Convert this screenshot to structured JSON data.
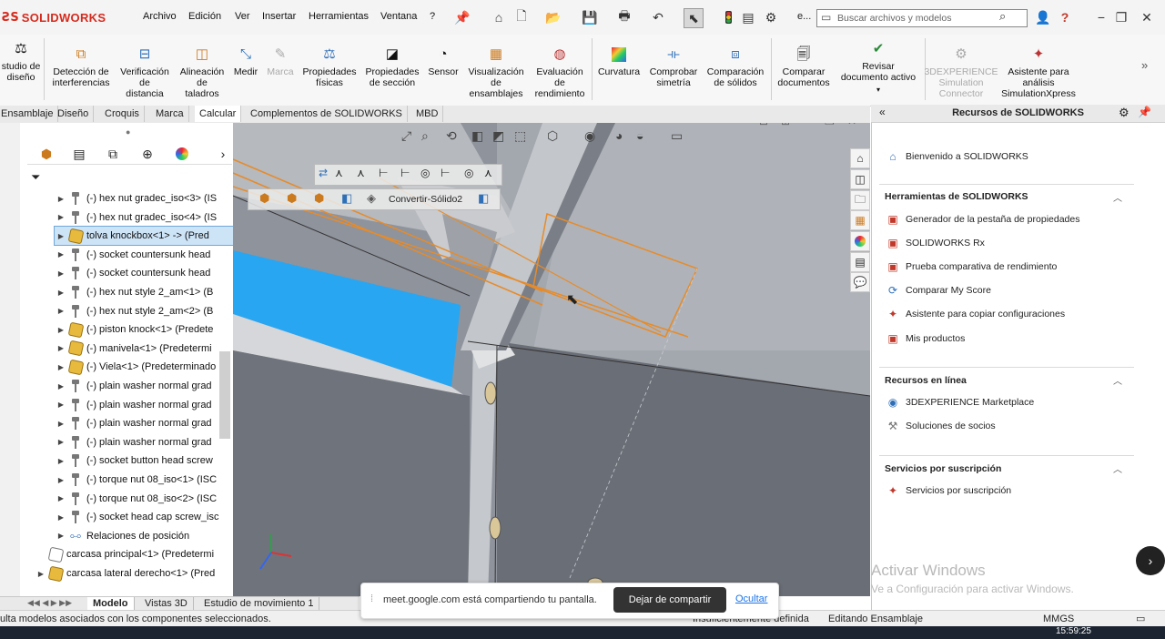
{
  "app": {
    "logo_text": "SOLIDWORKS",
    "menu": [
      "Archivo",
      "Edición",
      "Ver",
      "Insertar",
      "Herramientas",
      "Ventana",
      "?"
    ],
    "search_placeholder": "Buscar archivos y modelos",
    "truncated_e": "e..."
  },
  "ribbon": {
    "buttons": [
      {
        "label": "studio de\ndiseño",
        "icon": "design-study-icon"
      },
      {
        "label": "Detección de\ninterferencias",
        "icon": "interference-icon"
      },
      {
        "label": "Verificación\nde\ndistancia",
        "icon": "clearance-icon"
      },
      {
        "label": "Alineación\nde\ntaladros",
        "icon": "hole-alignment-icon"
      },
      {
        "label": "Medir",
        "icon": "measure-icon"
      },
      {
        "label": "Marca",
        "icon": "markup-icon",
        "disabled": true
      },
      {
        "label": "Propiedades\nfísicas",
        "icon": "mass-properties-icon"
      },
      {
        "label": "Propiedades\nde sección",
        "icon": "section-properties-icon"
      },
      {
        "label": "Sensor",
        "icon": "sensor-icon"
      },
      {
        "label": "Visualización\nde\nensamblajes",
        "icon": "assembly-visualization-icon"
      },
      {
        "label": "Evaluación\nde\nrendimiento",
        "icon": "performance-icon"
      },
      {
        "label": "Curvatura",
        "icon": "curvature-icon"
      },
      {
        "label": "Comprobar\nsimetría",
        "icon": "symmetry-icon"
      },
      {
        "label": "Comparación\nde sólidos",
        "icon": "compare-bodies-icon"
      },
      {
        "label": "Comparar\ndocumentos",
        "icon": "compare-documents-icon"
      },
      {
        "label": "Revisar\ndocumento activo",
        "icon": "check-active-document-icon"
      },
      {
        "label": "3DEXPERIENCE\nSimulation\nConnector",
        "icon": "3dexperience-icon",
        "disabled": true
      },
      {
        "label": "Asistente para\nanálisis\nSimulationXpress",
        "icon": "simulationxpress-icon"
      }
    ]
  },
  "tabs": [
    "Ensamblaje",
    "Diseño",
    "Croquis",
    "Marca",
    "Calcular",
    "Complementos de SOLIDWORKS",
    "MBD"
  ],
  "tabs_active": "Calcular",
  "tree": {
    "items": [
      {
        "label": "(-) hex nut gradec_iso<3> (IS",
        "type": "bolt"
      },
      {
        "label": "(-) hex nut gradec_iso<4> (IS",
        "type": "bolt"
      },
      {
        "label": "tolva knockbox<1> -> (Pred",
        "type": "assembly",
        "selected": true
      },
      {
        "label": "(-) socket countersunk head",
        "type": "bolt"
      },
      {
        "label": "(-) socket countersunk head",
        "type": "bolt"
      },
      {
        "label": "(-) hex nut style 2_am<1> (B",
        "type": "bolt"
      },
      {
        "label": "(-) hex nut style 2_am<2> (B",
        "type": "bolt"
      },
      {
        "label": "(-) piston knock<1> (Predete",
        "type": "assembly"
      },
      {
        "label": "(-) manivela<1> (Predetermi",
        "type": "assembly"
      },
      {
        "label": "(-) Viela<1> (Predeterminado",
        "type": "assembly"
      },
      {
        "label": "(-) plain washer normal grad",
        "type": "bolt"
      },
      {
        "label": "(-) plain washer normal grad",
        "type": "bolt"
      },
      {
        "label": "(-) plain washer normal grad",
        "type": "bolt"
      },
      {
        "label": "(-) plain washer normal grad",
        "type": "bolt"
      },
      {
        "label": "(-) socket button head screw",
        "type": "bolt"
      },
      {
        "label": "(-) torque nut 08_iso<1> (ISC",
        "type": "bolt"
      },
      {
        "label": "(-) torque nut 08_iso<2> (ISC",
        "type": "bolt"
      },
      {
        "label": "(-) socket head cap screw_isc",
        "type": "bolt"
      },
      {
        "label": "Relaciones de posición",
        "type": "mates"
      },
      {
        "label": "carcasa principal<1> (Predetermi",
        "type": "assembly-outline"
      },
      {
        "label": "carcasa lateral derecho<1> (Pred",
        "type": "assembly"
      }
    ]
  },
  "viewport": {
    "feature_label": "Convertir-Sólido2"
  },
  "bottom_tabs": [
    "Modelo",
    "Vistas 3D",
    "Estudio de movimiento 1"
  ],
  "bottom_tabs_active": "Modelo",
  "taskpane": {
    "title": "Recursos de SOLIDWORKS",
    "welcome": "Bienvenido a SOLIDWORKS",
    "sections": [
      {
        "title": "Herramientas de SOLIDWORKS",
        "items": [
          "Generador de la pestaña de propiedades",
          "SOLIDWORKS Rx",
          "Prueba comparativa de rendimiento",
          "Comparar My Score",
          "Asistente para copiar configuraciones",
          "Mis productos"
        ]
      },
      {
        "title": "Recursos en línea",
        "items": [
          "3DEXPERIENCE Marketplace",
          "Soluciones de socios"
        ]
      },
      {
        "title": "Servicios por suscripción",
        "items": [
          "Servicios por suscripción"
        ]
      }
    ]
  },
  "share_bar": {
    "message": "meet.google.com está compartiendo tu pantalla.",
    "stop_label": "Dejar de compartir",
    "hide_label": "Ocultar"
  },
  "watermark": {
    "line1": "Activar Windows",
    "line2": "Ve a Configuración para activar Windows."
  },
  "status": {
    "left": "ulta modelos asociados con los componentes seleccionados.",
    "definition": "Insuficientemente definida",
    "mode": "Editando Ensamblaje",
    "units": "MMGS"
  },
  "taskbar": {
    "time": "15:59:25"
  }
}
